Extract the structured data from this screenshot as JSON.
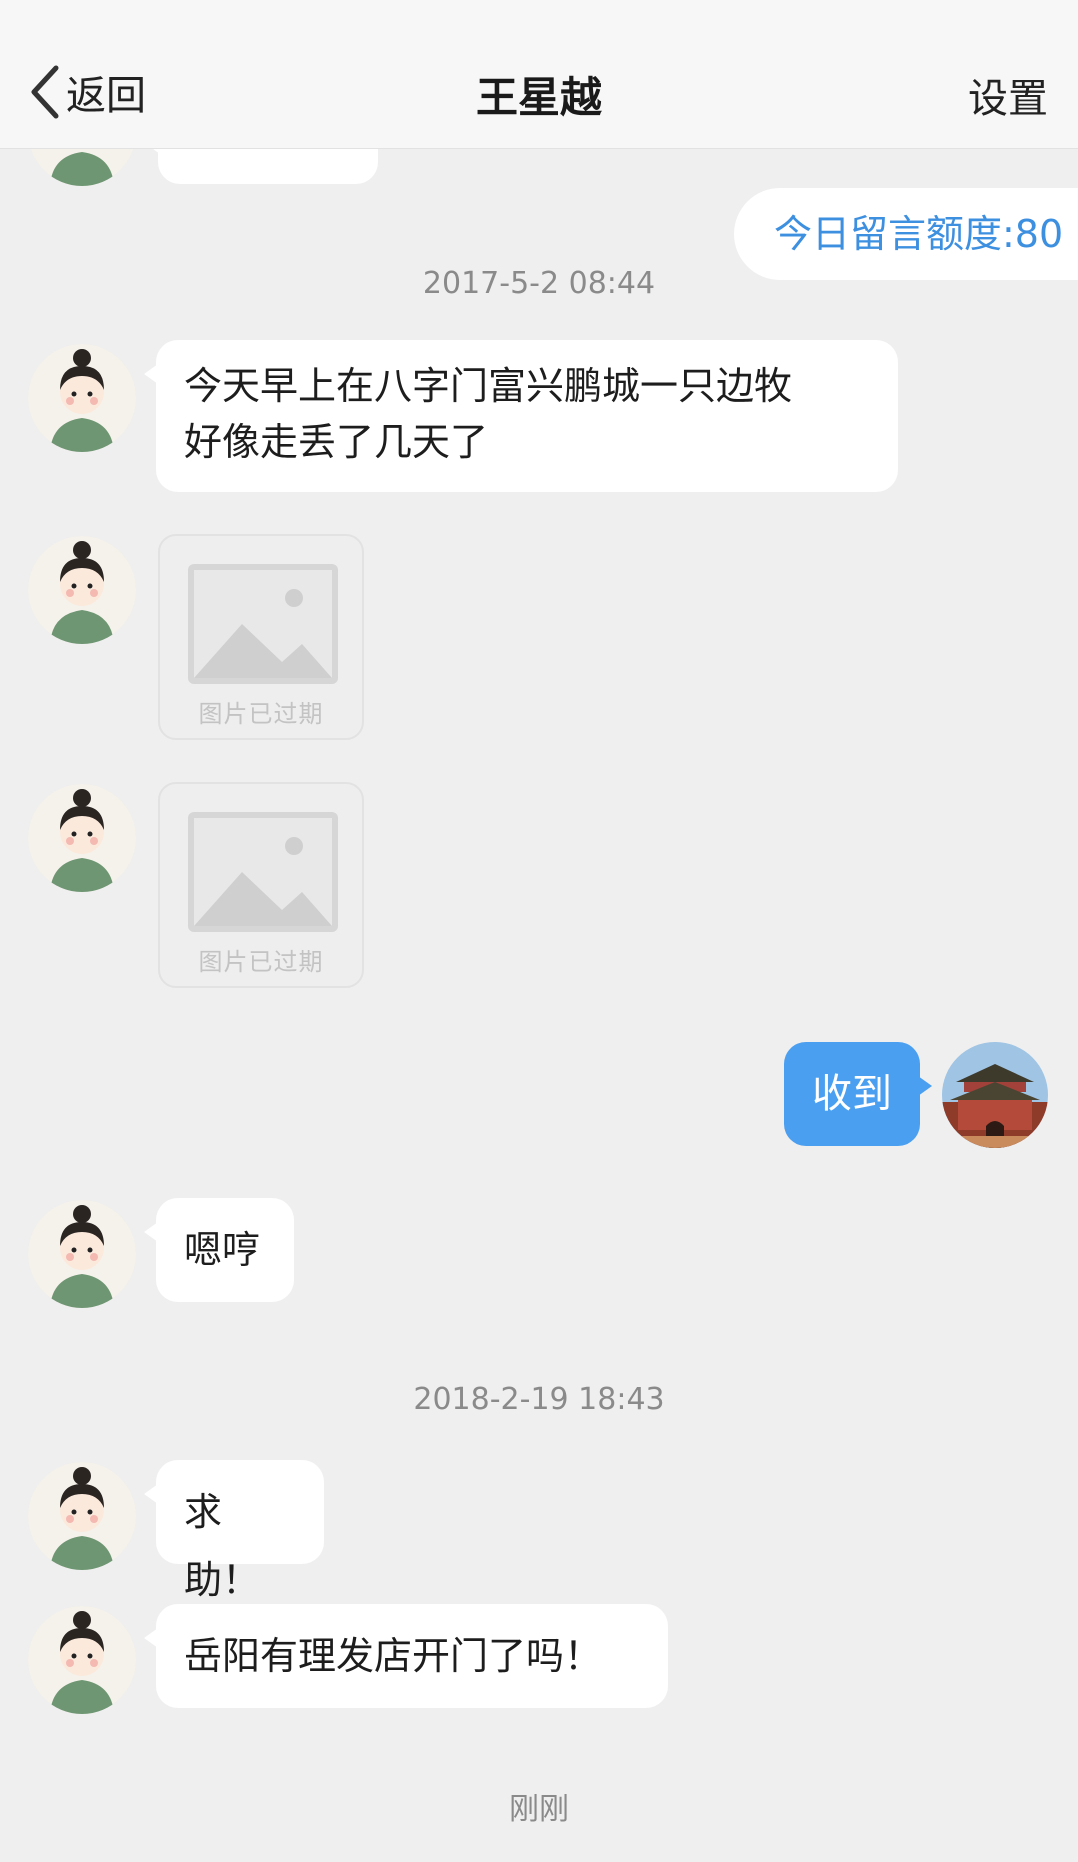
{
  "header": {
    "back_label": "返回",
    "title": "王星越",
    "settings_label": "设置"
  },
  "quota_text": "今日留言额度:80",
  "timestamps": [
    "2017-5-2 08:44",
    "2018-2-19 18:43",
    "刚刚"
  ],
  "messages": [
    {
      "from": "other",
      "text": "今天早上在八字门富兴鹏城一只边牧"
    },
    {
      "from": "other",
      "text": "好像走丢了几天了"
    },
    {
      "from": "other",
      "image_expired_label": "图片已过期"
    },
    {
      "from": "other",
      "image_expired_label": "图片已过期"
    },
    {
      "from": "me",
      "text": "收到"
    },
    {
      "from": "other",
      "text": "嗯哼"
    },
    {
      "from": "other",
      "text": "求助！"
    },
    {
      "from": "other",
      "text": "岳阳有理发店开门了吗！"
    }
  ],
  "colors": {
    "mine_bubble": "#4a9ff1",
    "quota_text": "#3d8fe0",
    "background": "#efefef"
  },
  "icons": {
    "back": "chevron-left-icon",
    "expired_image": "image-placeholder-icon"
  }
}
